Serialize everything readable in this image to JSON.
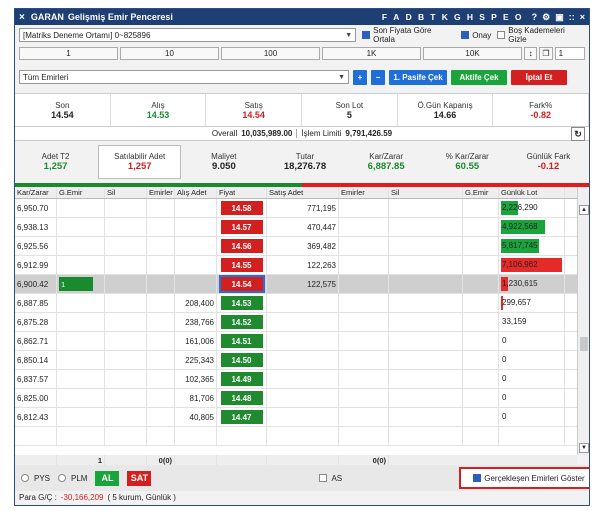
{
  "title": {
    "close": "×",
    "symbol": "GARAN",
    "name": "Gelişmiş Emir Penceresi",
    "letters": [
      "F",
      "A",
      "D",
      "B",
      "T",
      "K",
      "G",
      "H",
      "S",
      "P",
      "E",
      "O"
    ],
    "icons": [
      "?",
      "⚙",
      "▣",
      "::",
      "×"
    ]
  },
  "account": {
    "value": "[Matriks Deneme Ortamı] 0~825896",
    "opt1": "Son Fiyata Göre Ortala",
    "opt2": "Onay",
    "opt3": "Boş Kademeleri Gizle"
  },
  "qty_buttons": [
    "1",
    "10",
    "100",
    "1K",
    "10K"
  ],
  "qty_field": "1",
  "filter": {
    "value": "Tüm Emirleri",
    "plus": "+",
    "minus": "−",
    "pasif": "1. Pasife Çek",
    "aktif": "Aktife Çek",
    "iptal": "İptal Et"
  },
  "summary": [
    {
      "label": "Son",
      "value": "14.54",
      "color": "#222"
    },
    {
      "label": "Alış",
      "value": "14.53",
      "color": "#1a8a2e"
    },
    {
      "label": "Satış",
      "value": "14.54",
      "color": "#d21f1f"
    },
    {
      "label": "Son Lot",
      "value": "5",
      "color": "#222"
    },
    {
      "label": "Ö.Gün Kapanış",
      "value": "14.66",
      "color": "#222"
    },
    {
      "label": "Fark%",
      "value": "-0.82",
      "color": "#d21f1f"
    }
  ],
  "overall": {
    "label": "Overall",
    "value": "10,035,989.00",
    "limit_label": "İşlem Limiti",
    "limit_value": "9,791,426.59"
  },
  "positions": [
    {
      "label": "Adet T2",
      "value": "1,257",
      "color": "#1a8a2e"
    },
    {
      "label": "Satılabilir Adet",
      "value": "1,257",
      "color": "#d21f1f"
    },
    {
      "label": "Maliyet",
      "value": "9.050",
      "color": "#222"
    },
    {
      "label": "Tutar",
      "value": "18,276.78",
      "color": "#222"
    },
    {
      "label": "Kar/Zarar",
      "value": "6,887.85",
      "color": "#1a8a2e"
    },
    {
      "label": "% Kar/Zarar",
      "value": "60.55",
      "color": "#1a8a2e"
    },
    {
      "label": "Günlük Fark",
      "value": "-0.12",
      "color": "#d21f1f"
    }
  ],
  "columns": [
    "Kar/Zarar",
    "G.Emir",
    "Sil",
    "Emirler",
    "Alış Adet",
    "Fiyat",
    "Satış Adet",
    "Emirler",
    "Sil",
    "G.Emir",
    "Günlük Lot"
  ],
  "rows": [
    {
      "kz": "6,950.70",
      "ge": "",
      "aa": "",
      "fy": "14.58",
      "side": "red",
      "sa": "771,195",
      "lot": "2,226,290",
      "lotw": 0.28,
      "lotc": "g"
    },
    {
      "kz": "6,938.13",
      "ge": "",
      "aa": "",
      "fy": "14.57",
      "side": "red",
      "sa": "470,447",
      "lot": "4,922,568",
      "lotw": 0.72,
      "lotc": "g"
    },
    {
      "kz": "6,925.56",
      "ge": "",
      "aa": "",
      "fy": "14.56",
      "side": "red",
      "sa": "369,482",
      "lot": "5,817,745",
      "lotw": 0.62,
      "lotc": "g"
    },
    {
      "kz": "6,912.99",
      "ge": "",
      "aa": "",
      "fy": "14.55",
      "side": "red",
      "sa": "122,263",
      "lot": "7,106,962",
      "lotw": 1.0,
      "lotc": "r"
    },
    {
      "kz": "6,900.42",
      "ge": "1",
      "aa": "",
      "fy": "14.54",
      "side": "red",
      "sa": "122,575",
      "lot": "1,230,615",
      "lotw": 0.12,
      "lotc": "r",
      "current": true
    },
    {
      "kz": "6,887.85",
      "ge": "",
      "aa": "208,400",
      "fy": "14.53",
      "side": "green",
      "sa": "",
      "lot": "299,657",
      "lotw": 0.04,
      "lotc": "r"
    },
    {
      "kz": "6,875.28",
      "ge": "",
      "aa": "238,766",
      "fy": "14.52",
      "side": "green",
      "sa": "",
      "lot": "33,159",
      "lotw": 0,
      "lotc": "g"
    },
    {
      "kz": "6,862.71",
      "ge": "",
      "aa": "161,006",
      "fy": "14.51",
      "side": "green",
      "sa": "",
      "lot": "0",
      "lotw": 0,
      "lotc": "g"
    },
    {
      "kz": "6,850.14",
      "ge": "",
      "aa": "225,343",
      "fy": "14.50",
      "side": "green",
      "sa": "",
      "lot": "0",
      "lotw": 0,
      "lotc": "g"
    },
    {
      "kz": "6,837.57",
      "ge": "",
      "aa": "102,365",
      "fy": "14.49",
      "side": "green",
      "sa": "",
      "lot": "0",
      "lotw": 0,
      "lotc": "g"
    },
    {
      "kz": "6,825.00",
      "ge": "",
      "aa": "81,706",
      "fy": "14.48",
      "side": "green",
      "sa": "",
      "lot": "0",
      "lotw": 0,
      "lotc": "g"
    },
    {
      "kz": "6,812.43",
      "ge": "",
      "aa": "40,805",
      "fy": "14.47",
      "side": "green",
      "sa": "",
      "lot": "0",
      "lotw": 0,
      "lotc": "g"
    },
    {
      "kz": "",
      "ge": "",
      "aa": "",
      "fy": "",
      "side": "green",
      "sa": "",
      "lot": "",
      "lotw": 0,
      "lotc": "g"
    }
  ],
  "footer": {
    "ge": "1",
    "em": "0(0)",
    "em2": "0(0)"
  },
  "bottom": {
    "pys": "PYS",
    "plm": "PLM",
    "al": "AL",
    "sat": "SAT",
    "as": "AS",
    "gerceklesen": "Gerçekleşen Emirleri Göster"
  },
  "para": {
    "label": "Para G/Ç :",
    "value": "-30,166,209",
    "note": "( 5 kurum, Günlük )"
  }
}
